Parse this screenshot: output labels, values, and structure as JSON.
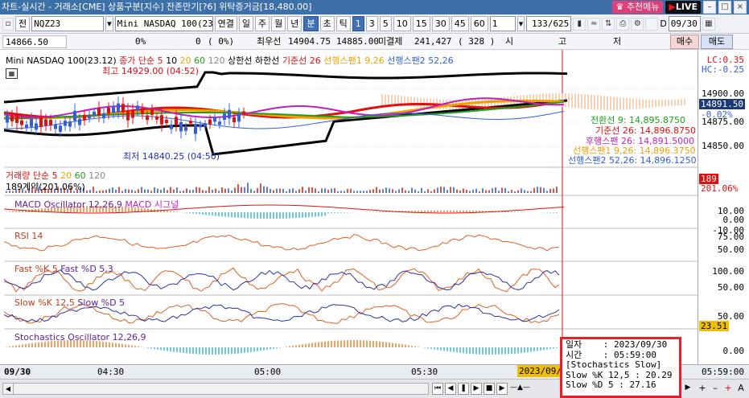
{
  "window": {
    "title": "차트-실시간 - 거래소[CME] 상품구분[지수] 잔존만기[?6] 위탁증거금[18,480.00]",
    "recommend_menu": "추천메뉴",
    "live": "LIVE"
  },
  "toolbar": {
    "jeon": "전",
    "symbol": "NQZ23",
    "name": "Mini NASDAQ 100(23.1",
    "buttons": [
      "연결",
      "일",
      "주",
      "월",
      "년",
      "분",
      "초",
      "틱"
    ],
    "selected_unit": "분",
    "intervals": [
      "1",
      "3",
      "5",
      "10",
      "15",
      "30",
      "45",
      "60"
    ],
    "selected_interval": "1",
    "interval_value": "1",
    "count": "133",
    "count_total": "625",
    "d_label": "D",
    "date": "09/30"
  },
  "quote": {
    "price": "14866.50",
    "change_pct": "0%",
    "zero": "0",
    "paren": "( 0%)",
    "best_sell_label": "최우선",
    "best_sell": "14904.75",
    "best_buy": "14885.00",
    "open_interest_label": "미결제",
    "open_interest": "241,427",
    "oi_change": "( 328 )",
    "si": "시",
    "go": "고",
    "jeo": "저",
    "buy": "매수",
    "sell": "매도"
  },
  "panes": {
    "price": {
      "title": "Mini NASDAQ 100(23.12)",
      "ma_label": "종가 단순 5",
      "ma_periods": [
        "10",
        "20",
        "60",
        "120"
      ],
      "upper": "상한선",
      "lower": "하한선",
      "base": "기준선 26",
      "span1": "선행스팬1 9,26",
      "span2": "선행스팬2 52,26",
      "high_note": "최고 14929.00 (04:52)",
      "low_note": "최저 14840.25 (04:50)",
      "lc": "LC:0.35",
      "hc": "HC:-0.25",
      "legend_conv": "전환선 9: 14,895.8750",
      "legend_base": "기준선 26: 14,896.8750",
      "legend_lag": "후행스팬 26: 14,891.5000",
      "legend_s1": "선행스팬1 9,26: 14,896.3750",
      "legend_s2": "선행스팬2 52,26: 14,896.1250",
      "axis": [
        "14900.00",
        "14875.00",
        "14850.00"
      ],
      "current": "14891.50",
      "current_pct": "-0.02%"
    },
    "volume": {
      "title": "거래량 단순 5",
      "periods": [
        "20",
        "60",
        "120"
      ],
      "sub": "189계약(201.06%)",
      "current": "189",
      "current_pct": "201.06%"
    },
    "macd": {
      "title": "MACD Oscillator 12,26,9",
      "macd": "MACD",
      "signal": "시그널",
      "axis": [
        "10.00",
        "0.00",
        "-10.00"
      ]
    },
    "rsi": {
      "title": "RSI 14",
      "axis": [
        "75.00",
        "50.00"
      ]
    },
    "fast": {
      "title": "Fast %K 5",
      "title2": "Fast %D 5,3",
      "axis": [
        "100.00",
        "50.00"
      ]
    },
    "slow": {
      "title": "Slow %K 12,5",
      "title2": "Slow %D 5",
      "axis": [
        "50.00"
      ],
      "current": "23.51"
    },
    "stoch_osc": {
      "title": "Stochastics Oscillator 12,26,9",
      "axis": [
        "0.00"
      ]
    }
  },
  "time_axis": {
    "date": "09/30",
    "ticks": [
      "04:30",
      "05:00",
      "05:30"
    ],
    "cursor_date": "2023/09/3",
    "cursor_time": "05:59:00"
  },
  "tooltip": {
    "date_label": "일자",
    "date": ": 2023/09/30",
    "time_label": "시간",
    "time": ": 05:59:00",
    "header": "[Stochastics Slow]",
    "k": "Slow %K 12,5 : 20.29",
    "d": "Slow %D 5 : 27.16"
  },
  "colors": {
    "red": "#e01010",
    "black": "#000000",
    "magenta": "#c020c0",
    "orange": "#f0a000",
    "green": "#20a020",
    "blue": "#3060e0",
    "cloud": "#f4a060"
  }
}
